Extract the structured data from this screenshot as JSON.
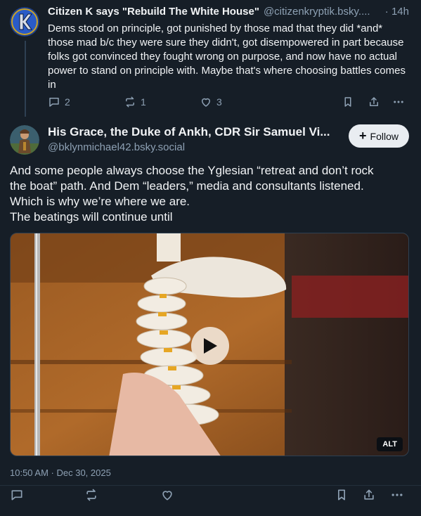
{
  "reply_post": {
    "author_name": "Citizen K says \"Rebuild The White House\"",
    "author_handle": "@citizenkryptik.bsky....",
    "time": "· 14h",
    "text": "Dems stood on principle, got punished by those mad that they did *and* those mad b/c they were sure they didn't, got disempowered in part because folks got convinced they fought wrong on purpose, and now have no actual power to stand on principle with. Maybe that's where choosing battles comes in",
    "reply_count": "2",
    "repost_count": "1",
    "like_count": "3"
  },
  "main_post": {
    "author_name": "His Grace, the Duke of Ankh, CDR Sir Samuel Vi...",
    "author_handle": "@bklynmichael42.bsky.social",
    "follow_label": "Follow",
    "text_lines": [
      "And some people always choose the Yglesian “retreat and don’t rock",
      "the boat” path. And Dem “leaders,” media and consultants listened.",
      "Which is why we’re where we are.",
      "The beatings will continue until"
    ],
    "video_alt_badge": "ALT",
    "timestamp": "10:50 AM · Dec 30, 2025"
  },
  "icons": [
    "reply-icon",
    "repost-icon",
    "like-icon",
    "bookmark-icon",
    "share-icon",
    "more-icon",
    "play-icon"
  ],
  "colors": {
    "background": "#161e27",
    "text": "#f1f3f5",
    "muted": "#8da0b3",
    "follow_bg": "#e9edf1"
  }
}
